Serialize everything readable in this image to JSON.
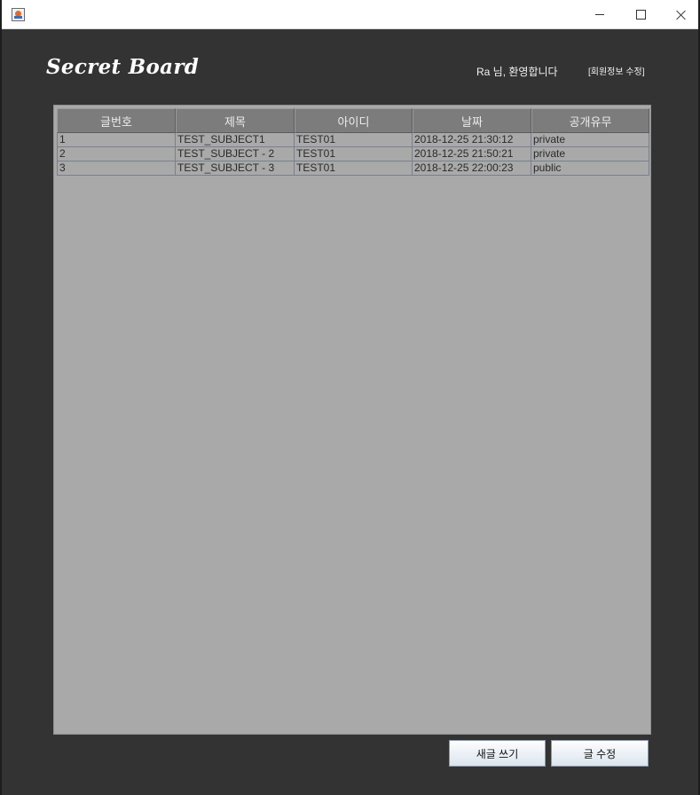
{
  "window": {
    "controls": {
      "minimize": "minimize",
      "maximize": "maximize",
      "close": "close"
    }
  },
  "header": {
    "brand": "Secret Board",
    "welcome": "Ra 님, 환영합니다",
    "member_info_link": "[회원정보 수정]"
  },
  "board": {
    "columns": [
      "글번호",
      "제목",
      "아이디",
      "날짜",
      "공개유무"
    ],
    "rows": [
      [
        "1",
        "TEST_SUBJECT1",
        "TEST01",
        "2018-12-25 21:30:12",
        "private"
      ],
      [
        "2",
        "TEST_SUBJECT - 2",
        "TEST01",
        "2018-12-25 21:50:21",
        "private"
      ],
      [
        "3",
        "TEST_SUBJECT - 3",
        "TEST01",
        "2018-12-25 22:00:23",
        "public"
      ]
    ]
  },
  "actions": {
    "new_post": "새글 쓰기",
    "edit_post": "글 수정"
  }
}
